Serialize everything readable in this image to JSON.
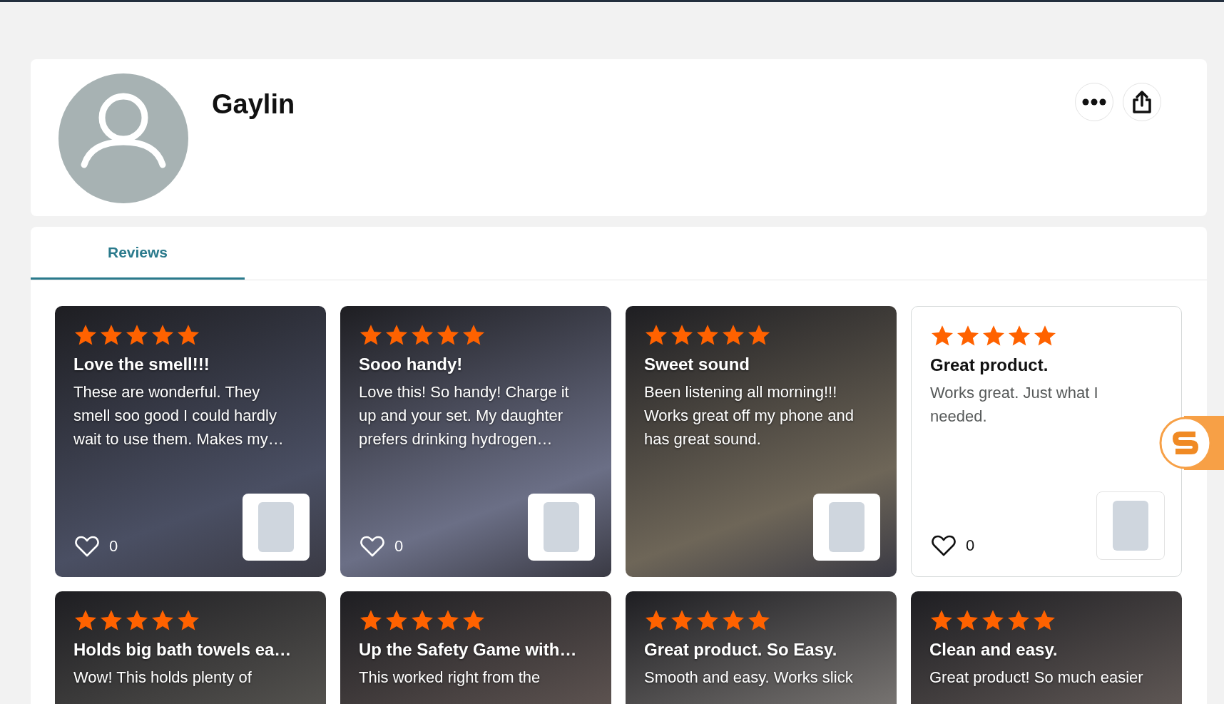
{
  "profile": {
    "name": "Gaylin"
  },
  "tabs": [
    {
      "label": "Reviews",
      "selected": true
    }
  ],
  "reviews": [
    {
      "kind": "photo",
      "stars": 5,
      "title": "Love the smell!!!",
      "body": "These are wonderful. They smell soo good I could hardly wait to use them. Makes my…",
      "likes": "0"
    },
    {
      "kind": "photo",
      "stars": 5,
      "title": "Sooo handy!",
      "body": "Love this! So handy! Charge it up and your set. My daughter prefers drinking hydrogen…",
      "likes": "0"
    },
    {
      "kind": "photo",
      "stars": 5,
      "title": "Sweet sound",
      "body": "Been listening all morning!!! Works great off my phone and has great sound."
    },
    {
      "kind": "text",
      "stars": 5,
      "title": "Great product.",
      "body": "Works great. Just what I needed.",
      "likes": "0"
    },
    {
      "kind": "photo",
      "stars": 5,
      "title": "Holds big bath towels ea…",
      "body": "Wow! This holds plenty of"
    },
    {
      "kind": "photo",
      "stars": 5,
      "title": "Up the Safety Game with…",
      "body": "This worked right from the"
    },
    {
      "kind": "photo",
      "stars": 5,
      "title": "Great product. So Easy.",
      "body": "Smooth and easy. Works slick"
    },
    {
      "kind": "photo",
      "stars": 5,
      "title": "Clean and easy.",
      "body": "Great product! So much easier"
    }
  ]
}
